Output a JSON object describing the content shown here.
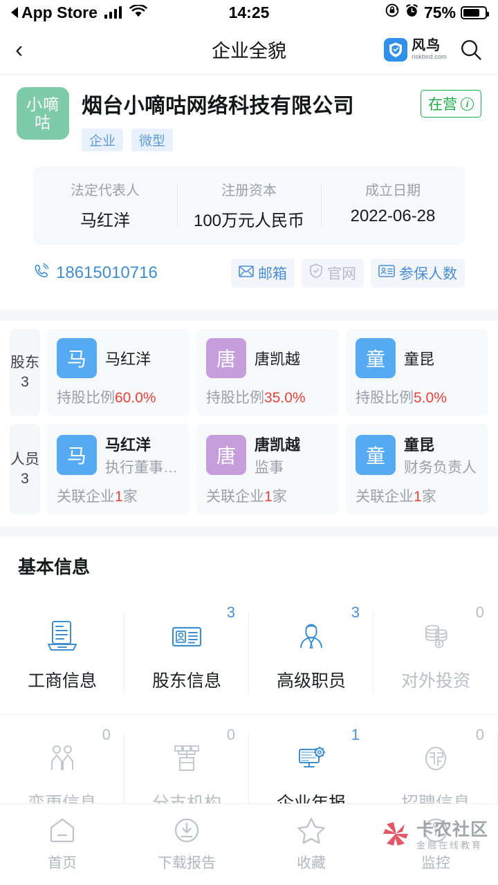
{
  "status_bar": {
    "carrier_back_label": "App Store",
    "time": "14:25",
    "battery_percent": "75%",
    "icons": [
      "signal-icon",
      "wifi-icon",
      "rotation-lock-icon",
      "alarm-icon",
      "battery-icon"
    ]
  },
  "nav": {
    "back_icon": "chevron-left-icon",
    "title": "企业全貌",
    "brand_cn": "风鸟",
    "brand_en": "riskbird.com",
    "search_icon": "search-icon"
  },
  "company": {
    "avatar_line1": "小嘀",
    "avatar_line2": "咕",
    "name": "烟台小嘀咕网络科技有限公司",
    "tags": [
      "企业",
      "微型"
    ],
    "status": "在营",
    "status_color": "#1aad45",
    "info": [
      {
        "label": "法定代表人",
        "value": "马红洋"
      },
      {
        "label": "注册资本",
        "value": "100万元人民币"
      },
      {
        "label": "成立日期",
        "value": "2022-06-28"
      }
    ],
    "phone": "18615010716",
    "chips": [
      {
        "label": "邮箱",
        "icon": "envelope-icon",
        "enabled": true
      },
      {
        "label": "官网",
        "icon": "shield-check-icon",
        "enabled": false
      },
      {
        "label": "参保人数",
        "icon": "id-card-icon",
        "enabled": true
      }
    ]
  },
  "shareholders": {
    "row_label": "股东",
    "count": "3",
    "items": [
      {
        "initial": "马",
        "color": "blue",
        "name": "马红洋",
        "meta_label": "持股比例",
        "meta_value": "60.0%"
      },
      {
        "initial": "唐",
        "color": "purple",
        "name": "唐凯越",
        "meta_label": "持股比例",
        "meta_value": "35.0%"
      },
      {
        "initial": "童",
        "color": "blue",
        "name": "童昆",
        "meta_label": "持股比例",
        "meta_value": "5.0%"
      }
    ]
  },
  "personnel": {
    "row_label": "人员",
    "count": "3",
    "items": [
      {
        "initial": "马",
        "color": "blue",
        "name": "马红洋",
        "role": "执行董事…",
        "meta_prefix": "关联企业",
        "meta_value": "1",
        "meta_suffix": "家"
      },
      {
        "initial": "唐",
        "color": "purple",
        "name": "唐凯越",
        "role": "监事",
        "meta_prefix": "关联企业",
        "meta_value": "1",
        "meta_suffix": "家"
      },
      {
        "initial": "童",
        "color": "blue",
        "name": "童昆",
        "role": "财务负责人",
        "meta_prefix": "关联企业",
        "meta_value": "1",
        "meta_suffix": "家"
      }
    ]
  },
  "basic_info": {
    "title": "基本信息",
    "items": [
      {
        "label": "工商信息",
        "count": "",
        "icon": "business-license-icon",
        "enabled": true
      },
      {
        "label": "股东信息",
        "count": "3",
        "icon": "id-card-icon",
        "enabled": true
      },
      {
        "label": "高级职员",
        "count": "3",
        "icon": "executive-icon",
        "enabled": true
      },
      {
        "label": "对外投资",
        "count": "0",
        "icon": "coins-icon",
        "enabled": false
      },
      {
        "label": "变更信息",
        "count": "0",
        "icon": "two-people-icon",
        "enabled": false
      },
      {
        "label": "分支机构",
        "count": "0",
        "icon": "branch-org-icon",
        "enabled": false
      },
      {
        "label": "企业年报",
        "count": "1",
        "icon": "monitor-gear-icon",
        "enabled": true
      },
      {
        "label": "招聘信息",
        "count": "0",
        "icon": "hiring-icon",
        "enabled": false
      }
    ]
  },
  "tabbar": {
    "items": [
      {
        "label": "首页",
        "icon": "home-icon"
      },
      {
        "label": "下载报告",
        "icon": "download-icon"
      },
      {
        "label": "收藏",
        "icon": "star-icon"
      },
      {
        "label": "监控",
        "icon": "monitor-eye-icon"
      }
    ]
  },
  "watermark": {
    "title": "卡农社区",
    "subtitle": "金融在线教育",
    "logo_color": "#e05060"
  }
}
